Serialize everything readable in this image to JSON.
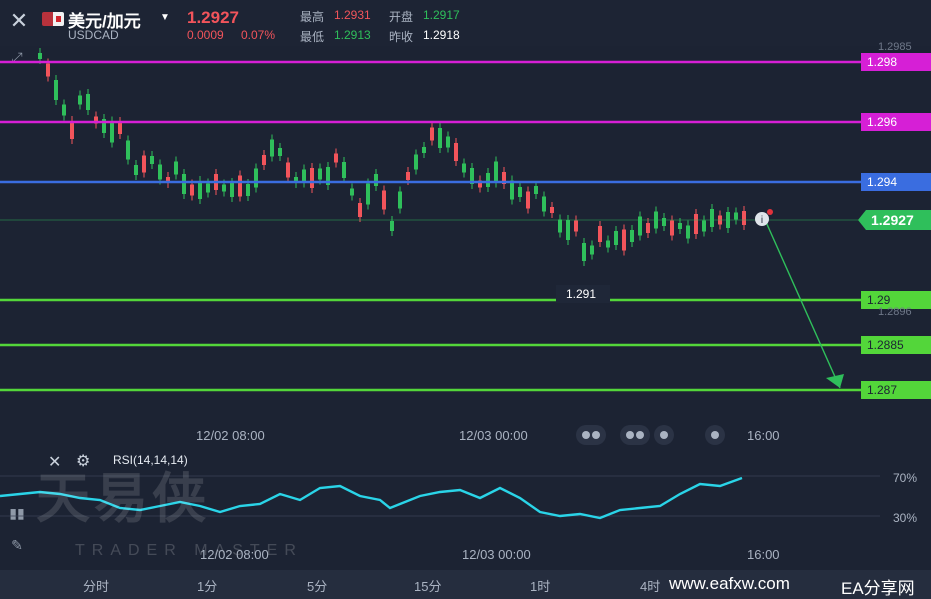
{
  "header": {
    "pair_name": "美元/加元",
    "pair_code": "USDCAD",
    "price": "1.2927",
    "change": "0.0009",
    "change_pct": "0.07%",
    "stats": [
      {
        "label": "最高",
        "value": "1.2931",
        "tone": "red"
      },
      {
        "label": "开盘",
        "value": "1.2917",
        "tone": "green"
      },
      {
        "label": "最低",
        "value": "1.2913",
        "tone": "green"
      },
      {
        "label": "昨收",
        "value": "1.2918",
        "tone": "white"
      }
    ]
  },
  "chart": {
    "horizontal_lines": [
      {
        "label": "1.298",
        "color": "#d61fd6"
      },
      {
        "label": "1.296",
        "color": "#d61fd6"
      },
      {
        "label": "1.294",
        "color": "#3a6de0"
      },
      {
        "label": "1.29",
        "color": "#53d63a"
      },
      {
        "label": "1.2885",
        "color": "#53d63a"
      },
      {
        "label": "1.287",
        "color": "#53d63a"
      }
    ],
    "current_price_tag": "1.2927",
    "axis_top": "1.2985",
    "axis_low": "1.2896",
    "low_annotation": "1.291",
    "time_labels": [
      "12/02 08:00",
      "12/03 00:00",
      "16:00"
    ]
  },
  "rsi": {
    "label": "RSI(14,14,14)",
    "level_high": "70%",
    "level_low": "30%",
    "time_labels": [
      "12/02 08:00",
      "12/03 00:00",
      "16:00"
    ],
    "line_color": "#2ad4e8"
  },
  "watermark": {
    "main": "天易侠",
    "sub": "TRADER MASTER"
  },
  "timeframes": [
    "分时",
    "1分",
    "5分",
    "15分",
    "1时",
    "4时"
  ],
  "footer": {
    "site_url": "www.eafxw.com",
    "site_name": "EA分享网"
  },
  "colors": {
    "background": "#1c2333",
    "up": "#2fbf5b",
    "down": "#f2545b"
  }
}
